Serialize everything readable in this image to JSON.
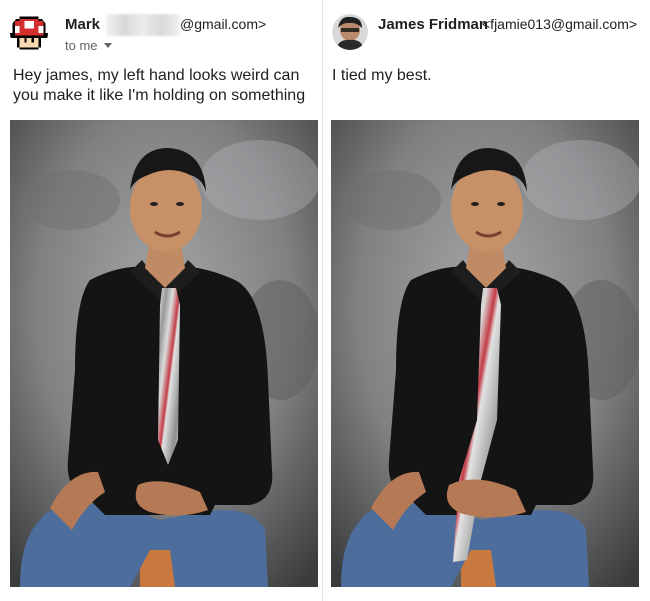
{
  "left_email": {
    "sender_name": "Mark",
    "sender_email_suffix": "@gmail.com>",
    "recipient_label": "to me",
    "body": "Hey james, my left hand looks weird can you make it like I'm holding on something",
    "avatar_icon": "mushroom-icon"
  },
  "right_email": {
    "sender_name": "James Fridman",
    "sender_email": "<fjamie013@gmail.com>",
    "body": "I tied my best.",
    "avatar_icon": "profile-photo"
  },
  "colors": {
    "backdrop": "#8f9192",
    "shirt": "#141414",
    "jeans": "#4d6e9c",
    "tie_stripe": "#c9c9c9",
    "tie_accent": "#c23b45",
    "mushroom_red": "#d32f2f"
  }
}
